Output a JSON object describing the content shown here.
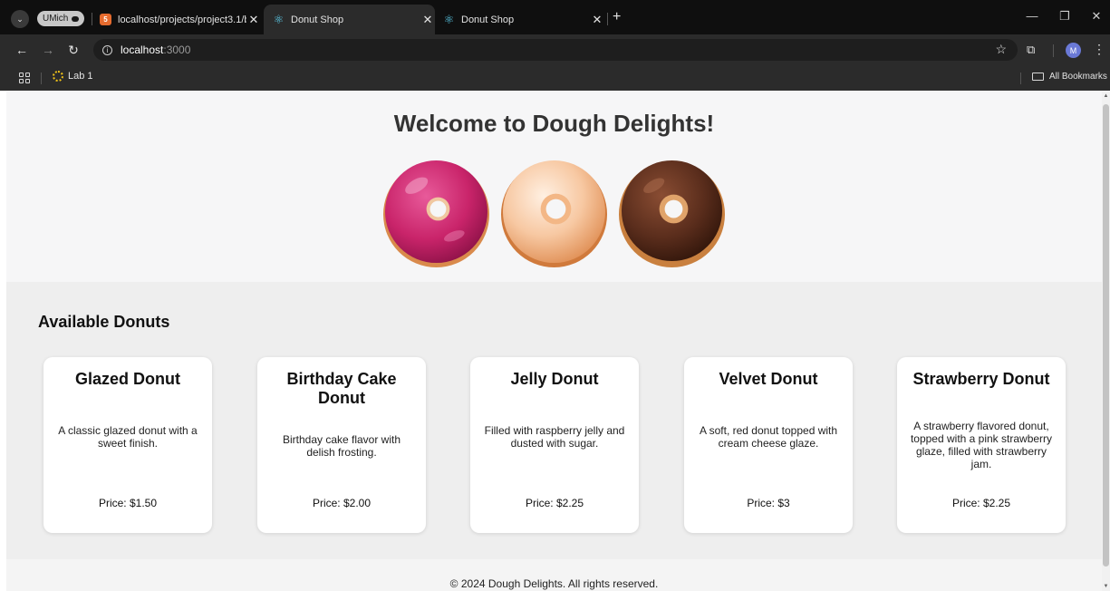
{
  "browser": {
    "profile_label": "UMich",
    "tabs": [
      {
        "title": "localhost/projects/project3.1/b",
        "favicon": "html-icon",
        "active": false
      },
      {
        "title": "Donut Shop",
        "favicon": "react-icon",
        "active": true
      },
      {
        "title": "Donut Shop",
        "favicon": "react-icon",
        "active": false
      }
    ],
    "new_tab": "+",
    "url_host": "localhost",
    "url_port": ":3000",
    "bookmarks": [
      {
        "label": "Lab 1",
        "icon": "lab-icon"
      }
    ],
    "all_bookmarks": "All Bookmarks",
    "avatar_initial": "M"
  },
  "page": {
    "heading": "Welcome to Dough Delights!",
    "hero_images": [
      {
        "name": "pink-frosted-donut",
        "frosting": "#c9246a"
      },
      {
        "name": "glazed-donut",
        "frosting": "#f7c8a2"
      },
      {
        "name": "chocolate-donut",
        "frosting": "#5a2d1c"
      }
    ],
    "section_title": "Available Donuts",
    "donuts": [
      {
        "name": "Glazed Donut",
        "description": "A classic glazed donut with a sweet finish.",
        "price": "Price: $1.50"
      },
      {
        "name": "Birthday Cake Donut",
        "description": "Birthday cake flavor with delish frosting.",
        "price": "Price: $2.00"
      },
      {
        "name": "Jelly Donut",
        "description": "Filled with raspberry jelly and dusted with sugar.",
        "price": "Price: $2.25"
      },
      {
        "name": "Velvet Donut",
        "description": "A soft, red donut topped with cream cheese glaze.",
        "price": "Price: $3"
      },
      {
        "name": "Strawberry Donut",
        "description": "A strawberry flavored donut, topped with a pink strawberry glaze, filled with strawberry jam.",
        "price": "Price: $2.25"
      }
    ],
    "footer": "© 2024 Dough Delights. All rights reserved."
  },
  "colors": {
    "chrome_dark": "#0f0f0f",
    "chrome_bar": "#2b2b2b",
    "page_bg": "#f4f4f4",
    "card_bg": "#ffffff",
    "heading": "#333333"
  }
}
